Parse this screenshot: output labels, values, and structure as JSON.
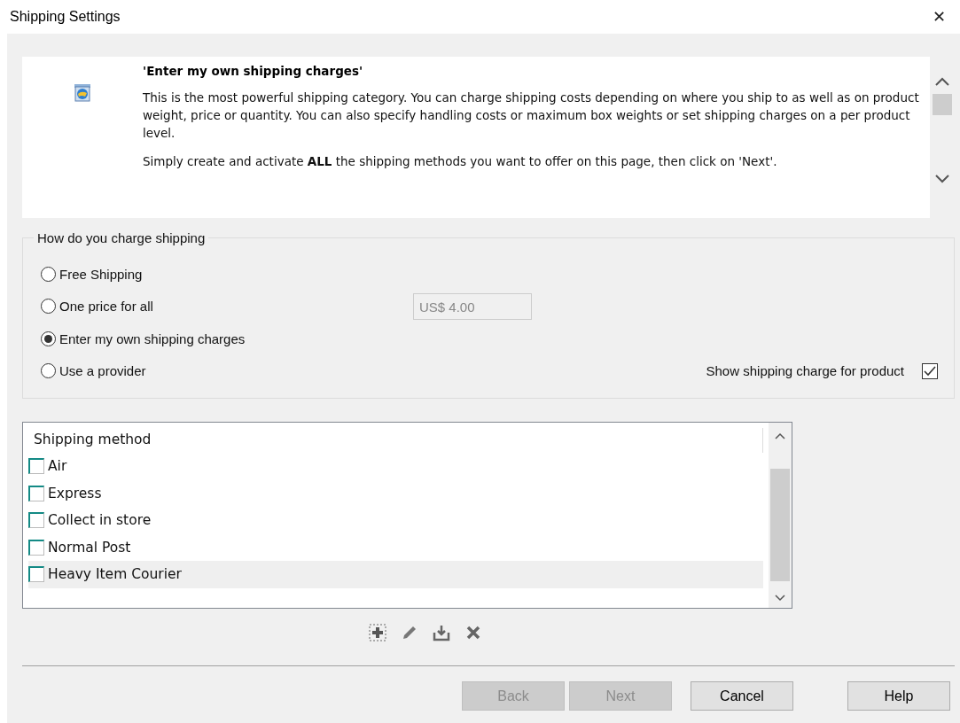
{
  "window": {
    "title": "Shipping Settings",
    "close": "✕"
  },
  "info": {
    "heading": "'Enter my own shipping charges'",
    "paragraphs": [
      "This is the most powerful shipping category. You can charge shipping costs depending on where you ship to as well as on product weight, price or quantity. You can also specify handling costs or maximum box weights or set shipping charges on a per product level.",
      "Simply create and activate **ALL** the shipping methods you want to offer  on this page, then click on 'Next'."
    ]
  },
  "charge_group": {
    "legend": "How do you charge shipping",
    "options": [
      {
        "label": "Free Shipping",
        "selected": false
      },
      {
        "label": "One price for all",
        "selected": false,
        "price_field": {
          "value": "US$ 4.00",
          "disabled": true
        }
      },
      {
        "label": "Enter my own shipping charges",
        "selected": true
      },
      {
        "label": "Use a provider",
        "selected": false
      }
    ],
    "show_charge": {
      "label": "Show shipping charge for product",
      "checked": true
    }
  },
  "methods": {
    "header": "Shipping method",
    "items": [
      {
        "label": "Air",
        "checked": false,
        "selected": false
      },
      {
        "label": "Express",
        "checked": false,
        "selected": false
      },
      {
        "label": "Collect in store",
        "checked": false,
        "selected": false
      },
      {
        "label": "Normal Post",
        "checked": false,
        "selected": false
      },
      {
        "label": "Heavy Item Courier",
        "checked": false,
        "selected": true
      }
    ]
  },
  "buttons": [
    {
      "label": "Back",
      "disabled": true
    },
    {
      "label": "Next",
      "disabled": true
    },
    {
      "label": "Cancel",
      "disabled": false
    },
    {
      "label": "Help",
      "disabled": false
    }
  ]
}
